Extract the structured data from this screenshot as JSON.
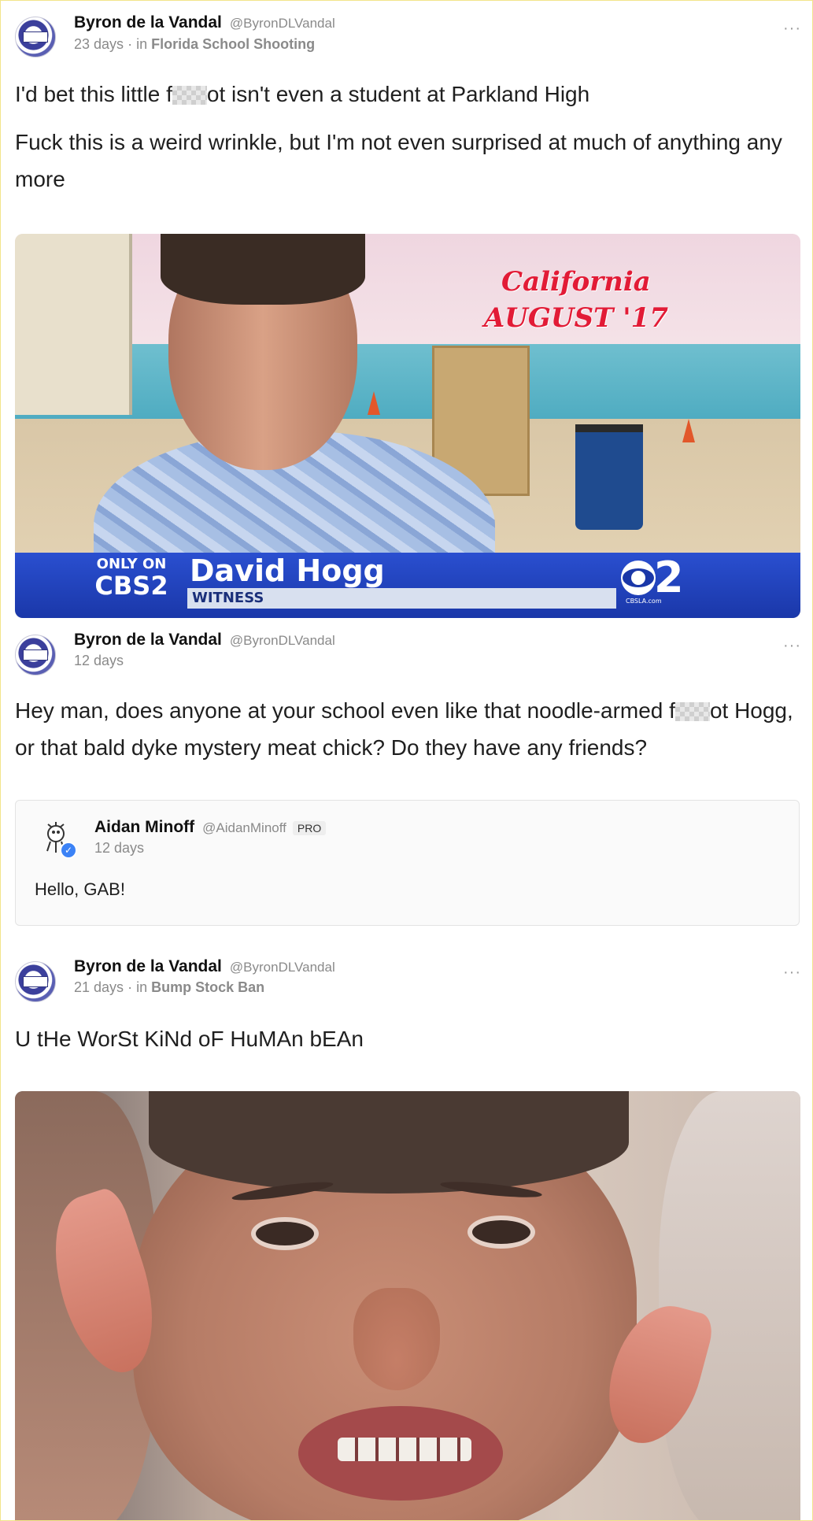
{
  "posts": [
    {
      "author": "Byron de la Vandal",
      "handle": "@ByronDLVandal",
      "time": "23 days",
      "in_label": "in",
      "group": "Florida School Shooting",
      "line1_before": "I'd bet this little f",
      "line1_after": "ot isn't even a student at Parkland High",
      "line2": "Fuck this is a weird wrinkle, but I'm not even surprised at much of anything any more",
      "image": {
        "caption_line1": "California",
        "caption_line2": "AUGUST '17",
        "only_on": "ONLY ON",
        "channel": "CBS2",
        "lower_third_name": "David Hogg",
        "lower_third_role": "WITNESS",
        "logo_sub": "CBSLA.com"
      }
    },
    {
      "author": "Byron de la Vandal",
      "handle": "@ByronDLVandal",
      "time": "12 days",
      "text_before": "Hey man, does anyone at your school even like that noodle-armed f",
      "text_after": "ot Hogg, or that bald dyke mystery meat chick? Do they have any friends?",
      "quote": {
        "author": "Aidan Minoff",
        "handle": "@AidanMinoff",
        "badge": "PRO",
        "time": "12 days",
        "text": "Hello, GAB!"
      }
    },
    {
      "author": "Byron de la Vandal",
      "handle": "@ByronDLVandal",
      "time": "21 days",
      "in_label": "in",
      "group": "Bump Stock Ban",
      "text": "U tHe WorSt KiNd oF HuMAn bEAn"
    }
  ],
  "ui": {
    "more_menu": "···",
    "meta_sep": "·",
    "verified_mark": "✓"
  },
  "icons": {
    "avatar": "vandal-avatar-icon",
    "quote_avatar": "cartoon-avatar-icon",
    "more": "more-options-icon",
    "verified": "verified-badge-icon"
  },
  "colors": {
    "censor": "#cfcfcf",
    "muted_text": "#8a8a8a",
    "lower_third_blue": "#1a37a8",
    "caption_red": "#e21b36"
  }
}
